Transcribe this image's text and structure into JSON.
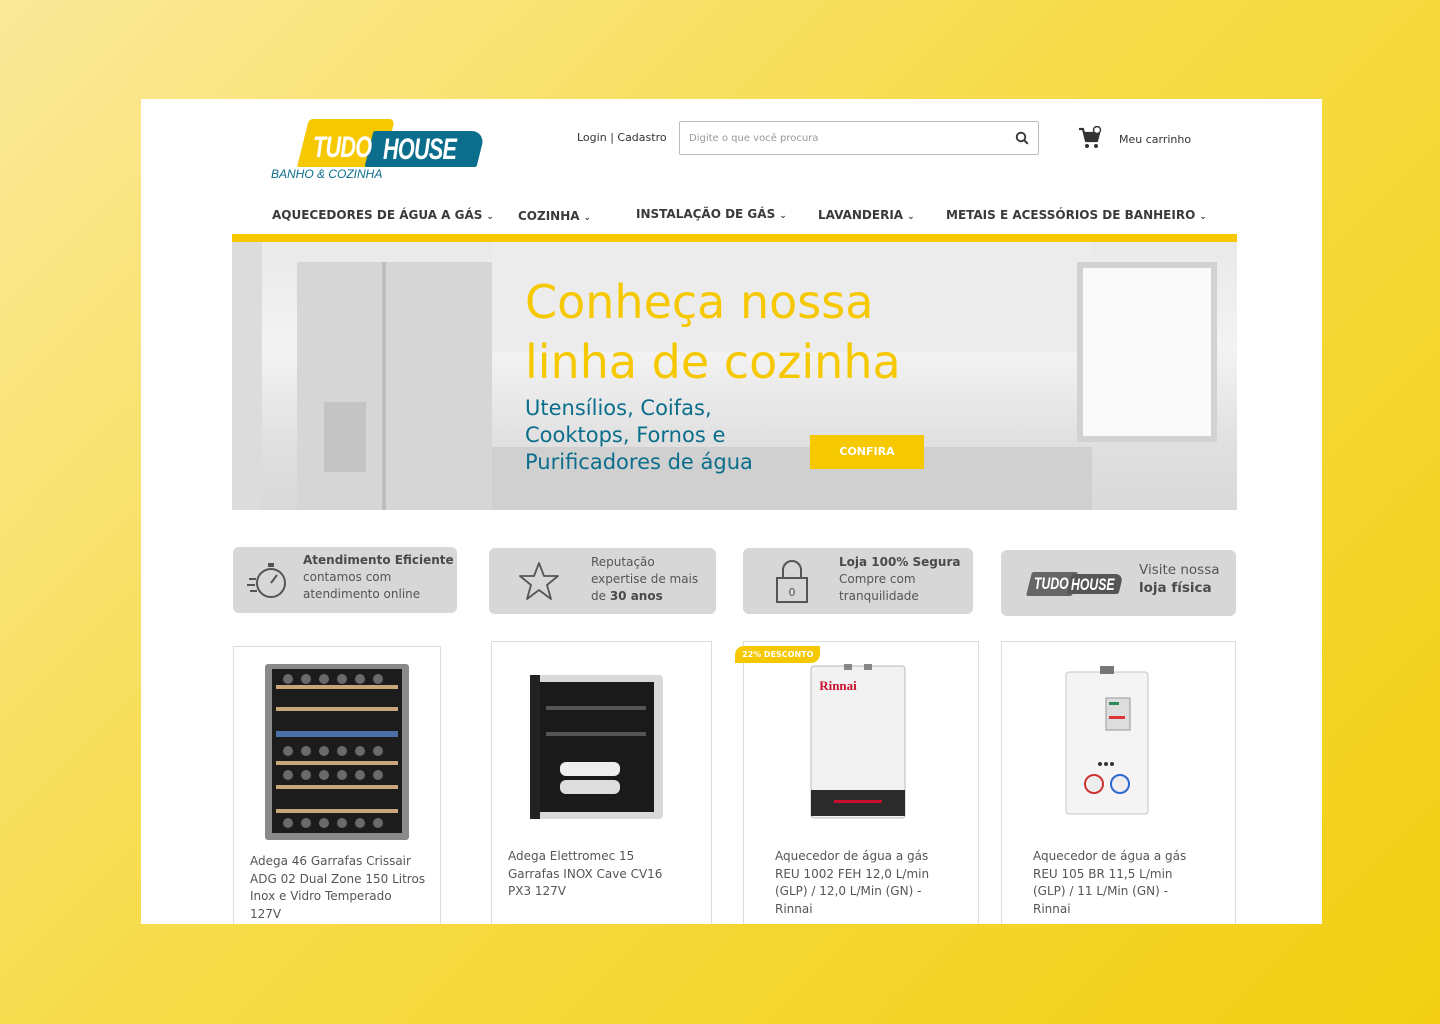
{
  "brand": {
    "logo_word1": "TUDO",
    "logo_word2": "HOUSE",
    "tagline": "BANHO & COZINHA",
    "primary_color": "#f6c800",
    "secondary_color": "#0b6e8c"
  },
  "header": {
    "login_label": "Login",
    "signup_label": "Cadastro",
    "search_placeholder": "Digite o que você procura",
    "search_icon": "search-icon",
    "cart_icon": "cart-icon",
    "cart_label": "Meu carrinho"
  },
  "nav": [
    {
      "label": "AQUECEDORES DE ÁGUA A GÁS"
    },
    {
      "label": "COZINHA"
    },
    {
      "label": "INSTALAÇÃO DE GÁS"
    },
    {
      "label": "LAVANDERIA"
    },
    {
      "label": "METAIS E ACESSÓRIOS DE BANHEIRO"
    }
  ],
  "banner": {
    "headline_line1": "Conheça nossa",
    "headline_line2": "linha de cozinha",
    "sub_line1": "Utensílios, Coifas,",
    "sub_line2": "Cooktops, Fornos e",
    "sub_line3": "Purificadores de água",
    "cta_label": "CONFIRA"
  },
  "features": [
    {
      "icon": "stopwatch-icon",
      "title": "Atendimento Eficiente",
      "line1": "contamos com",
      "line2": "atendimento online"
    },
    {
      "icon": "star-icon",
      "line1": "Reputação",
      "line2": "expertise de mais",
      "line3_prefix": "de ",
      "line3_bold": "30 anos"
    },
    {
      "icon": "padlock-icon",
      "title": "Loja 100% Segura",
      "line1": "Compre com",
      "line2": "tranquilidade"
    },
    {
      "icon": "store-logo-icon",
      "logo_word1": "TUDO",
      "logo_word2": "HOUSE",
      "line1": "Visite nossa",
      "line2_bold": "loja física"
    }
  ],
  "products": [
    {
      "name_lines": [
        "Adega 46 Garrafas Crissair",
        "ADG 02 Dual Zone 150 Litros",
        "Inox e Vidro Temperado",
        "127V"
      ]
    },
    {
      "name_lines": [
        "Adega Elettromec 15",
        "Garrafas INOX Cave CV16",
        "PX3 127V"
      ]
    },
    {
      "badge": "22% DESCONTO",
      "brand_label": "Rinnai",
      "name_lines": [
        "Aquecedor de água a gás",
        "REU 1002 FEH 12,0 L/min",
        "(GLP) / 12,0 L/Min (GN) -",
        "Rinnai"
      ]
    },
    {
      "name_lines": [
        "Aquecedor de água a gás",
        "REU 105 BR  11,5 L/min",
        "(GLP) / 11 L/Min (GN) -",
        "Rinnai"
      ]
    }
  ]
}
